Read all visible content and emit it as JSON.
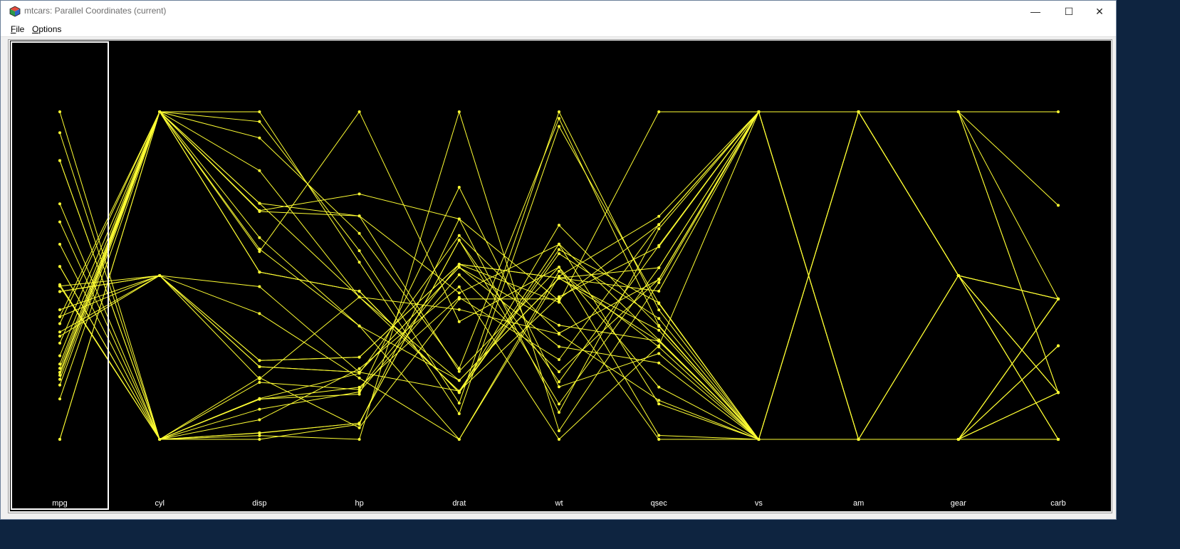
{
  "window": {
    "title": "mtcars: Parallel Coordinates (current)",
    "controls": {
      "minimize": "—",
      "maximize": "☐",
      "close": "✕"
    }
  },
  "menu": [
    {
      "mnemonic": "F",
      "rest": "ile"
    },
    {
      "mnemonic": "O",
      "rest": "ptions"
    }
  ],
  "colors": {
    "background": "#000000",
    "line": "#ffff33",
    "selection_box": "#ffffff",
    "label": "#ffffff"
  },
  "chart_data": {
    "type": "parallel-coordinates",
    "dataset": "mtcars",
    "axes": [
      "mpg",
      "cyl",
      "disp",
      "hp",
      "drat",
      "wt",
      "qsec",
      "vs",
      "am",
      "gear",
      "carb"
    ],
    "selected_axis": "mpg",
    "scaling": "each axis scaled independently to the minimum and maximum of the variable",
    "rows": [
      [
        21,
        6,
        160,
        110,
        3.9,
        2.62,
        16.46,
        0,
        1,
        4,
        4
      ],
      [
        21,
        6,
        160,
        110,
        3.9,
        2.875,
        17.02,
        0,
        1,
        4,
        4
      ],
      [
        22.8,
        4,
        108,
        93,
        3.85,
        2.32,
        18.61,
        1,
        1,
        4,
        1
      ],
      [
        21.4,
        6,
        258,
        110,
        3.08,
        3.215,
        19.44,
        1,
        0,
        3,
        1
      ],
      [
        18.7,
        8,
        360,
        175,
        3.15,
        3.44,
        17.02,
        0,
        0,
        3,
        2
      ],
      [
        18.1,
        6,
        225,
        105,
        2.76,
        3.46,
        20.22,
        1,
        0,
        3,
        1
      ],
      [
        14.3,
        8,
        360,
        245,
        3.21,
        3.57,
        15.84,
        0,
        0,
        3,
        4
      ],
      [
        24.4,
        4,
        146.7,
        62,
        3.69,
        3.19,
        20,
        1,
        0,
        4,
        2
      ],
      [
        22.8,
        4,
        140.8,
        95,
        3.92,
        3.15,
        22.9,
        1,
        0,
        4,
        2
      ],
      [
        19.2,
        6,
        167.6,
        123,
        3.92,
        3.44,
        18.3,
        1,
        0,
        4,
        4
      ],
      [
        17.8,
        6,
        167.6,
        123,
        3.92,
        3.44,
        18.9,
        1,
        0,
        4,
        4
      ],
      [
        16.4,
        8,
        275.8,
        180,
        3.07,
        4.07,
        17.4,
        0,
        0,
        3,
        3
      ],
      [
        17.3,
        8,
        275.8,
        180,
        3.07,
        3.73,
        17.6,
        0,
        0,
        3,
        3
      ],
      [
        15.2,
        8,
        275.8,
        180,
        3.07,
        3.78,
        18,
        0,
        0,
        3,
        3
      ],
      [
        10.4,
        8,
        472,
        205,
        2.93,
        5.25,
        17.98,
        0,
        0,
        3,
        4
      ],
      [
        10.4,
        8,
        460,
        215,
        3,
        5.424,
        17.82,
        0,
        0,
        3,
        4
      ],
      [
        14.7,
        8,
        440,
        230,
        3.23,
        5.345,
        17.42,
        0,
        0,
        3,
        4
      ],
      [
        32.4,
        4,
        78.7,
        66,
        4.08,
        2.2,
        19.47,
        1,
        1,
        4,
        1
      ],
      [
        30.4,
        4,
        75.7,
        52,
        4.93,
        1.615,
        18.52,
        1,
        1,
        4,
        2
      ],
      [
        33.9,
        4,
        71.1,
        65,
        4.22,
        1.835,
        19.9,
        1,
        1,
        4,
        1
      ],
      [
        21.5,
        4,
        120.1,
        97,
        3.7,
        2.465,
        20.01,
        1,
        0,
        3,
        1
      ],
      [
        15.5,
        8,
        318,
        150,
        2.76,
        3.52,
        16.87,
        0,
        0,
        3,
        2
      ],
      [
        15.2,
        8,
        304,
        150,
        3.15,
        3.435,
        17.3,
        0,
        0,
        3,
        2
      ],
      [
        13.3,
        8,
        350,
        245,
        3.73,
        3.84,
        15.41,
        0,
        0,
        3,
        4
      ],
      [
        19.2,
        8,
        400,
        175,
        3.08,
        3.845,
        17.05,
        0,
        0,
        3,
        2
      ],
      [
        27.3,
        4,
        79,
        66,
        4.08,
        1.935,
        18.9,
        1,
        1,
        4,
        1
      ],
      [
        26,
        4,
        120.3,
        91,
        4.43,
        2.14,
        16.7,
        0,
        1,
        5,
        2
      ],
      [
        30.4,
        4,
        95.1,
        113,
        3.77,
        1.513,
        16.9,
        1,
        1,
        5,
        2
      ],
      [
        15.8,
        8,
        351,
        264,
        4.22,
        3.17,
        14.5,
        0,
        1,
        5,
        4
      ],
      [
        19.7,
        6,
        145,
        175,
        3.62,
        2.77,
        15.5,
        0,
        1,
        5,
        6
      ],
      [
        15,
        8,
        301,
        335,
        3.54,
        3.57,
        14.6,
        0,
        1,
        5,
        8
      ],
      [
        21.4,
        4,
        121,
        109,
        4.11,
        2.78,
        18.6,
        1,
        1,
        4,
        2
      ]
    ]
  }
}
